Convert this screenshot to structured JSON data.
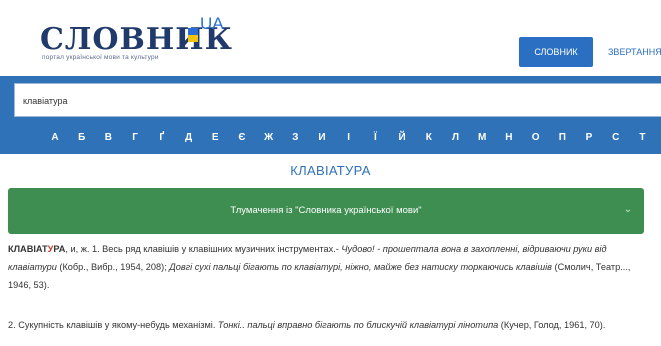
{
  "header": {
    "logo_word": "СЛОВНИК",
    "logo_ua": "UA",
    "logo_tagline": "портал української мови та культури",
    "nav": [
      {
        "label": "СЛОВНИК",
        "active": true
      },
      {
        "label": "ЗВЕРТАННЯ",
        "active": false
      }
    ]
  },
  "search": {
    "value": "клавіатура",
    "placeholder": ""
  },
  "alphabet": [
    "А",
    "Б",
    "В",
    "Г",
    "Ґ",
    "Д",
    "Е",
    "Є",
    "Ж",
    "З",
    "И",
    "І",
    "Ї",
    "Й",
    "К",
    "Л",
    "М",
    "Н",
    "О",
    "П",
    "Р",
    "С",
    "Т"
  ],
  "entry": {
    "title": "КЛАВІАТУРА",
    "source_toggle": "Тлумачення із \"Словника української мови\"",
    "p1": {
      "head_pre": "КЛАВІАТ",
      "head_stress": "У",
      "head_post": "РА",
      "gram": ", и, ж. 1. Весь ряд клавішів у клавішних музичних інструментах.- ",
      "quote1": "Чудово! - прошептала вона в захопленні, відриваючи руки від клавіатури",
      "ref1": " (Кобр., Вибр., 1954, 208); ",
      "quote2": "Довгі сухі пальці бігають по клавіатурі, ніжно, майже без натиску торкаючись клавішів",
      "ref2": " (Смолич, Театр..., 1946, 53)."
    },
    "p2": {
      "num_def": "2. Сукупність клавішів у якому-небудь механізмі. ",
      "quote": "Тонкі.. пальці вправно бігають по блискучій клавіатурі лінотипа",
      "ref": " (Кучер, Голод, 1961, 70)."
    }
  },
  "colors": {
    "brand_blue": "#2f72b8",
    "accent_green": "#3e8e51",
    "stress_red": "#c0392b"
  }
}
